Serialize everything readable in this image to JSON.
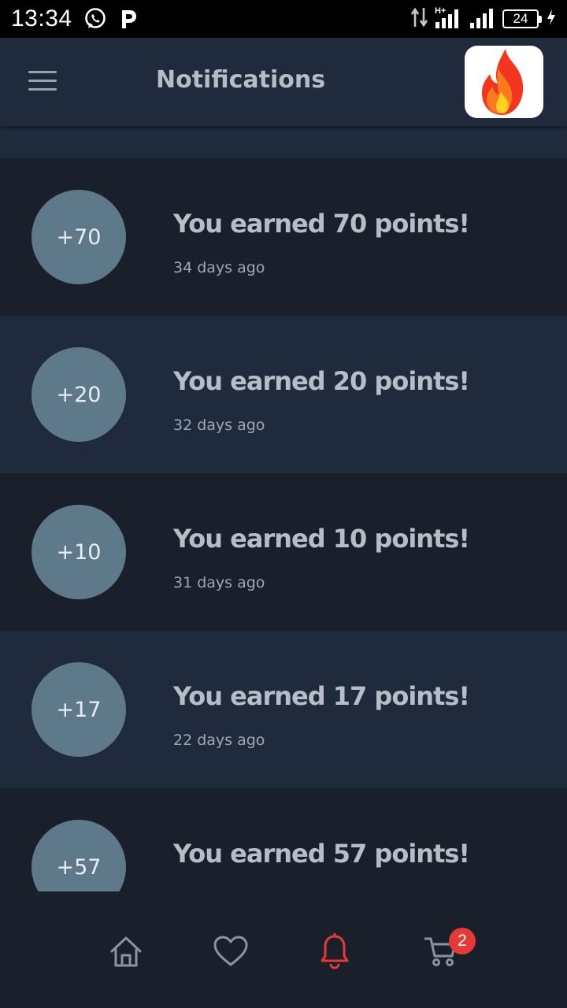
{
  "status_bar": {
    "time": "13:34",
    "battery": "24",
    "icons": [
      "whatsapp-icon",
      "parking-p-icon",
      "data-arrows-icon",
      "hplus-signal-icon",
      "signal-icon",
      "battery-icon",
      "charging-bolt-icon"
    ]
  },
  "header": {
    "title": "Notifications",
    "menu_icon": "hamburger-menu-icon",
    "logo_icon": "fire-logo-icon"
  },
  "notifications": [
    {
      "badge": "+70",
      "title": "You earned 70 points!",
      "time": "34 days ago"
    },
    {
      "badge": "+20",
      "title": "You earned 20 points!",
      "time": "32 days ago"
    },
    {
      "badge": "+10",
      "title": "You earned 10 points!",
      "time": "31 days ago"
    },
    {
      "badge": "+17",
      "title": "You earned 17 points!",
      "time": "22 days ago"
    },
    {
      "badge": "+57",
      "title": "You earned 57 points!",
      "time": ""
    }
  ],
  "bottom_nav": {
    "items": [
      {
        "icon": "home-icon",
        "active": false
      },
      {
        "icon": "heart-icon",
        "active": false
      },
      {
        "icon": "bell-icon",
        "active": true
      },
      {
        "icon": "cart-icon",
        "active": false
      }
    ],
    "cart_count": "2",
    "active_color": "#e53935",
    "inactive_color": "#8b939f"
  },
  "colors": {
    "background": "#1a202b",
    "header": "#1f2a3d",
    "badge": "#5e7a8a",
    "accent": "#e53935"
  }
}
